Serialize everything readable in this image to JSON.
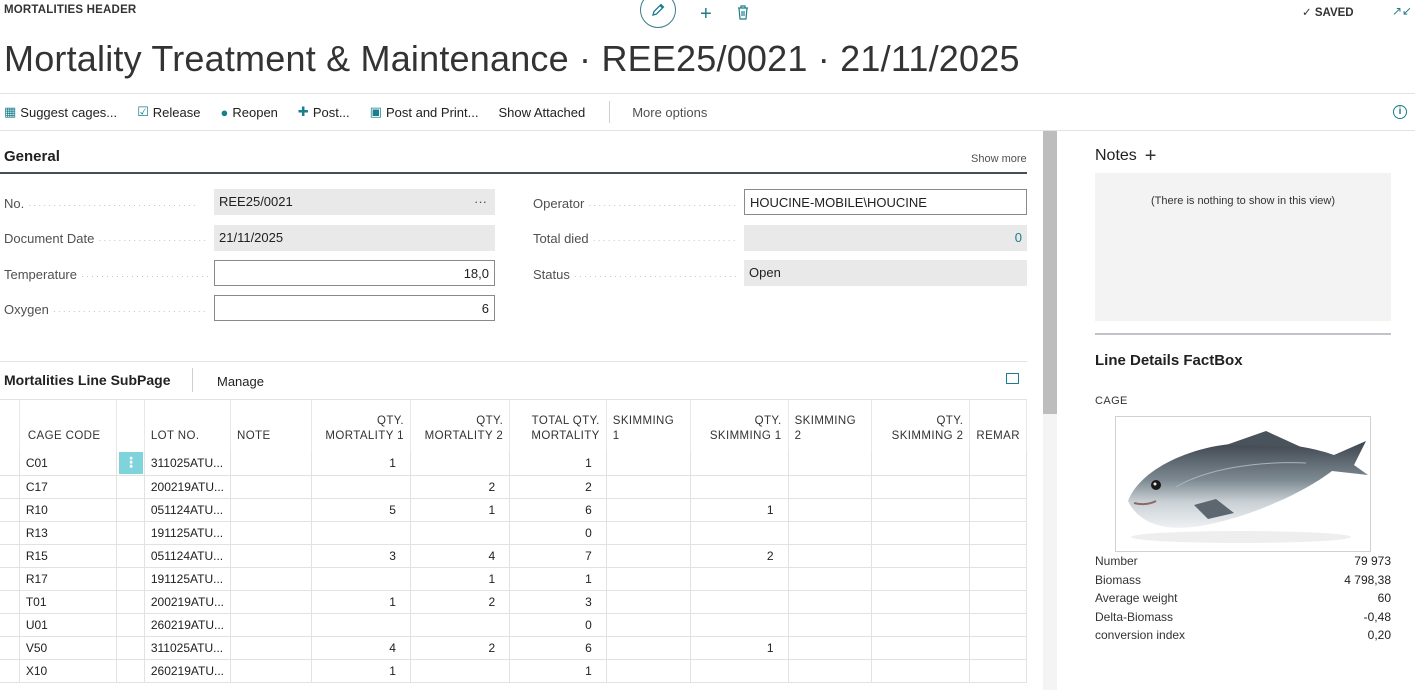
{
  "caption": "MORTALITIES HEADER",
  "saved": "✓ SAVED",
  "title": "Mortality Treatment & Maintenance · REE25/0021 · 21/11/2025",
  "actions": {
    "suggest": "Suggest cages...",
    "release": "Release",
    "reopen": "Reopen",
    "post": "Post...",
    "post_print": "Post and Print...",
    "show_attached": "Show Attached",
    "more": "More options"
  },
  "general": {
    "heading": "General",
    "show_more": "Show more",
    "no_label": "No.",
    "no_value": "REE25/0021",
    "no_assist": "···",
    "date_label": "Document Date",
    "date_value": "21/11/2025",
    "temp_label": "Temperature",
    "temp_value": "18,0",
    "oxygen_label": "Oxygen",
    "oxygen_value": "6",
    "operator_label": "Operator",
    "operator_value": "HOUCINE-MOBILE\\HOUCINE",
    "died_label": "Total died",
    "died_value": "0",
    "status_label": "Status",
    "status_value": "Open"
  },
  "subpage": {
    "title": "Mortalities Line SubPage",
    "manage": "Manage",
    "columns": {
      "cage": "CAGE CODE",
      "lot": "LOT NO.",
      "note": "NOTE",
      "qm1a": "QTY.",
      "qm1b": "MORTALITY 1",
      "qm2a": "QTY.",
      "qm2b": "MORTALITY 2",
      "tqa": "TOTAL QTY.",
      "tqb": "MORTALITY",
      "sk1a": "SKIMMING",
      "sk1b": "1",
      "qs1a": "QTY.",
      "qs1b": "SKIMMING 1",
      "sk2a": "SKIMMING",
      "sk2b": "2",
      "qs2a": "QTY.",
      "qs2b": "SKIMMING 2",
      "remark": "REMAR"
    },
    "rows": [
      {
        "cage": "C01",
        "lot": "311025ATU...",
        "m1": "1",
        "m2": "",
        "tot": "1",
        "s1": ""
      },
      {
        "cage": "C17",
        "lot": "200219ATU...",
        "m1": "",
        "m2": "2",
        "tot": "2",
        "s1": ""
      },
      {
        "cage": "R10",
        "lot": "051124ATU...",
        "m1": "5",
        "m2": "1",
        "tot": "6",
        "s1": "1"
      },
      {
        "cage": "R13",
        "lot": "191125ATU...",
        "m1": "",
        "m2": "",
        "tot": "0",
        "s1": ""
      },
      {
        "cage": "R15",
        "lot": "051124ATU...",
        "m1": "3",
        "m2": "4",
        "tot": "7",
        "s1": "2"
      },
      {
        "cage": "R17",
        "lot": "191125ATU...",
        "m1": "",
        "m2": "1",
        "tot": "1",
        "s1": ""
      },
      {
        "cage": "T01",
        "lot": "200219ATU...",
        "m1": "1",
        "m2": "2",
        "tot": "3",
        "s1": ""
      },
      {
        "cage": "U01",
        "lot": "260219ATU...",
        "m1": "",
        "m2": "",
        "tot": "0",
        "s1": ""
      },
      {
        "cage": "V50",
        "lot": "311025ATU...",
        "m1": "4",
        "m2": "2",
        "tot": "6",
        "s1": "1"
      },
      {
        "cage": "X10",
        "lot": "260219ATU...",
        "m1": "1",
        "m2": "",
        "tot": "1",
        "s1": ""
      }
    ]
  },
  "factbox": {
    "notes_title": "Notes",
    "notes_empty": "(There is nothing to show in this view)",
    "line_details_title": "Line Details FactBox",
    "cage_caption": "CAGE",
    "stats": [
      {
        "label": "Number",
        "value": "79 973"
      },
      {
        "label": "Biomass",
        "value": "4 798,38"
      },
      {
        "label": "Average weight",
        "value": "60"
      },
      {
        "label": "Delta-Biomass",
        "value": "-0,48"
      },
      {
        "label": "conversion index",
        "value": "0,20"
      }
    ]
  },
  "icons": {
    "edit": "pencil-icon",
    "new": "plus-icon",
    "delete": "trash-icon",
    "info": "info-icon"
  },
  "colors": {
    "accent": "#1b7e8c",
    "selected_row_marker": "#7fd4dc",
    "readonly_field": "#e9e9e9"
  }
}
